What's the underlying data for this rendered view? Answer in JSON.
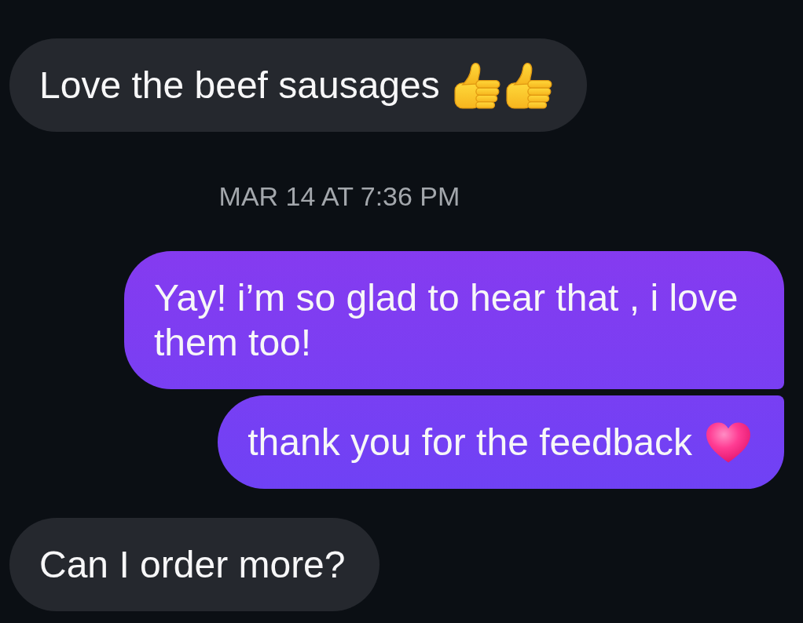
{
  "messages": [
    {
      "kind": "received",
      "text": "Love the beef sausages",
      "icons": [
        {
          "kind": "thumbs_up"
        },
        {
          "kind": "thumbs_up"
        }
      ]
    },
    {
      "kind": "timestamp",
      "text": "MAR 14 AT 7:36 PM"
    },
    {
      "kind": "sent",
      "text": "Yay! i’m so glad to hear that , i love them too!"
    },
    {
      "kind": "sent",
      "text": "thank you for the feedback",
      "icons": [
        {
          "kind": "heart"
        }
      ]
    },
    {
      "kind": "received",
      "text": "Can I order more?"
    }
  ]
}
